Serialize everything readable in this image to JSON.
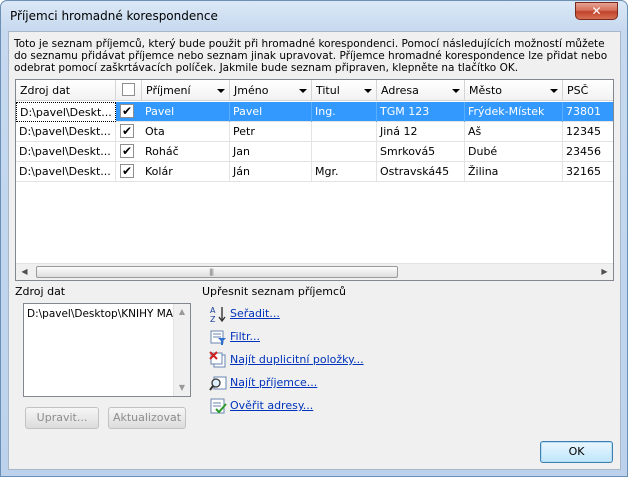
{
  "window": {
    "title": "Příjemci hromadné korespondence",
    "close_label": "✕"
  },
  "intro_text": "Toto je seznam příjemců, který bude použit při hromadné korespondenci. Pomocí následujících možností můžete do seznamu přidávat příjemce nebo seznam jinak upravovat. Příjemce hromadné korespondence lze přidat nebo odebrat pomocí zaškrtávacích políček. Jakmile bude seznam připraven, klepněte na tlačítko OK.",
  "grid": {
    "columns": [
      "Zdroj dat",
      "",
      "Příjmení",
      "Jméno",
      "Titul",
      "Adresa",
      "Město",
      "PSČ"
    ],
    "rows": [
      {
        "source": "D:\\pavel\\Deskt...",
        "checked": "✔",
        "surname": "Pavel",
        "name": "Pavel",
        "title": "Ing.",
        "address": "TGM 123",
        "city": "Frýdek-Místek",
        "zip": "73801"
      },
      {
        "source": "D:\\pavel\\Deskt...",
        "checked": "✔",
        "surname": "Ota",
        "name": "Petr",
        "title": "",
        "address": "Jiná 12",
        "city": "Aš",
        "zip": "12345"
      },
      {
        "source": "D:\\pavel\\Deskt...",
        "checked": "✔",
        "surname": "Roháč",
        "name": "Jan",
        "title": "",
        "address": "Smrková5",
        "city": "Dubé",
        "zip": "23456"
      },
      {
        "source": "D:\\pavel\\Deskt...",
        "checked": "✔",
        "surname": "Kolár",
        "name": "Ján",
        "title": "Mgr.",
        "address": "Ostravská45",
        "city": "Žilina",
        "zip": "32165"
      }
    ]
  },
  "source_panel": {
    "label": "Zdroj dat",
    "item": "D:\\pavel\\Desktop\\KNIHY MANU",
    "edit_button": "Upravit...",
    "refresh_button": "Aktualizovat"
  },
  "refine": {
    "label": "Upřesnit seznam příjemců",
    "links": [
      "Seřadit...",
      "Filtr...",
      "Najít duplicitní položky...",
      "Najít příjemce...",
      "Ověřit adresy..."
    ]
  },
  "ok_button": "OK"
}
